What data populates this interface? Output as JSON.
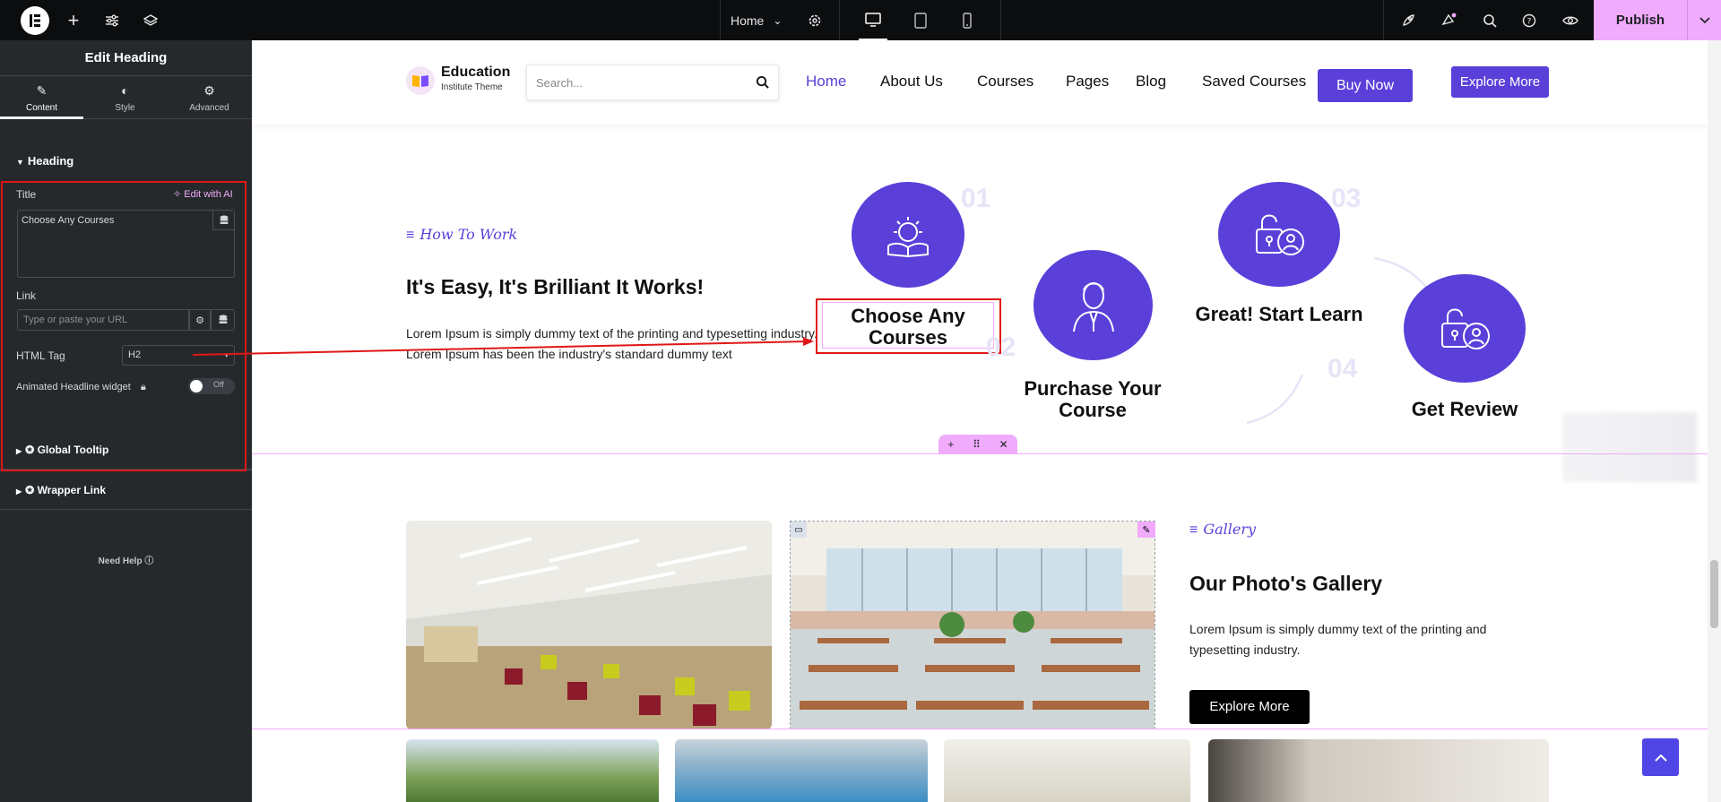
{
  "topbar": {
    "page_select": "Home",
    "publish_label": "Publish"
  },
  "panel": {
    "title": "Edit Heading",
    "tabs": [
      {
        "label": "Content",
        "icon": "pencil-icon"
      },
      {
        "label": "Style",
        "icon": "half-circle-icon"
      },
      {
        "label": "Advanced",
        "icon": "gear-icon"
      }
    ],
    "heading_section": "Heading",
    "title_label": "Title",
    "edit_ai_label": "Edit with AI",
    "title_value": "Choose Any Courses",
    "link_label": "Link",
    "link_placeholder": "Type or paste your URL",
    "html_tag_label": "HTML Tag",
    "html_tag_value": "H2",
    "animated_label": "Animated Headline widget",
    "toggle_label": "Off",
    "global_tooltip": "Global Tooltip",
    "wrapper_link": "Wrapper Link",
    "need_help": "Need Help"
  },
  "site": {
    "logo_title": "Education",
    "logo_subtitle": "Institute Theme",
    "search_placeholder": "Search...",
    "nav": [
      "Home",
      "About Us",
      "Courses",
      "Pages",
      "Blog",
      "Saved Courses"
    ],
    "buy_now": "Buy Now",
    "explore_more": "Explore More"
  },
  "how": {
    "tag": "How To Work",
    "heading": "It's Easy, It's Brilliant It Works!",
    "body": "Lorem Ipsum is simply dummy text of the printing and typesetting industry. Lorem Ipsum has been the industry's standard dummy text",
    "steps": [
      {
        "num": "01",
        "title": "Choose Any Courses"
      },
      {
        "num": "02",
        "title": "Purchase Your Course"
      },
      {
        "num": "03",
        "title": "Great! Start Learn"
      },
      {
        "num": "04",
        "title": "Get Review"
      }
    ]
  },
  "gallery": {
    "tag": "Gallery",
    "heading": "Our Photo's Gallery",
    "body": "Lorem Ipsum is simply dummy text of the printing and typesetting industry.",
    "button": "Explore More"
  },
  "colors": {
    "accent": "#5b3fd9",
    "publish": "#f0abfc",
    "panel": "#26292c",
    "annotation": "#e01717"
  }
}
